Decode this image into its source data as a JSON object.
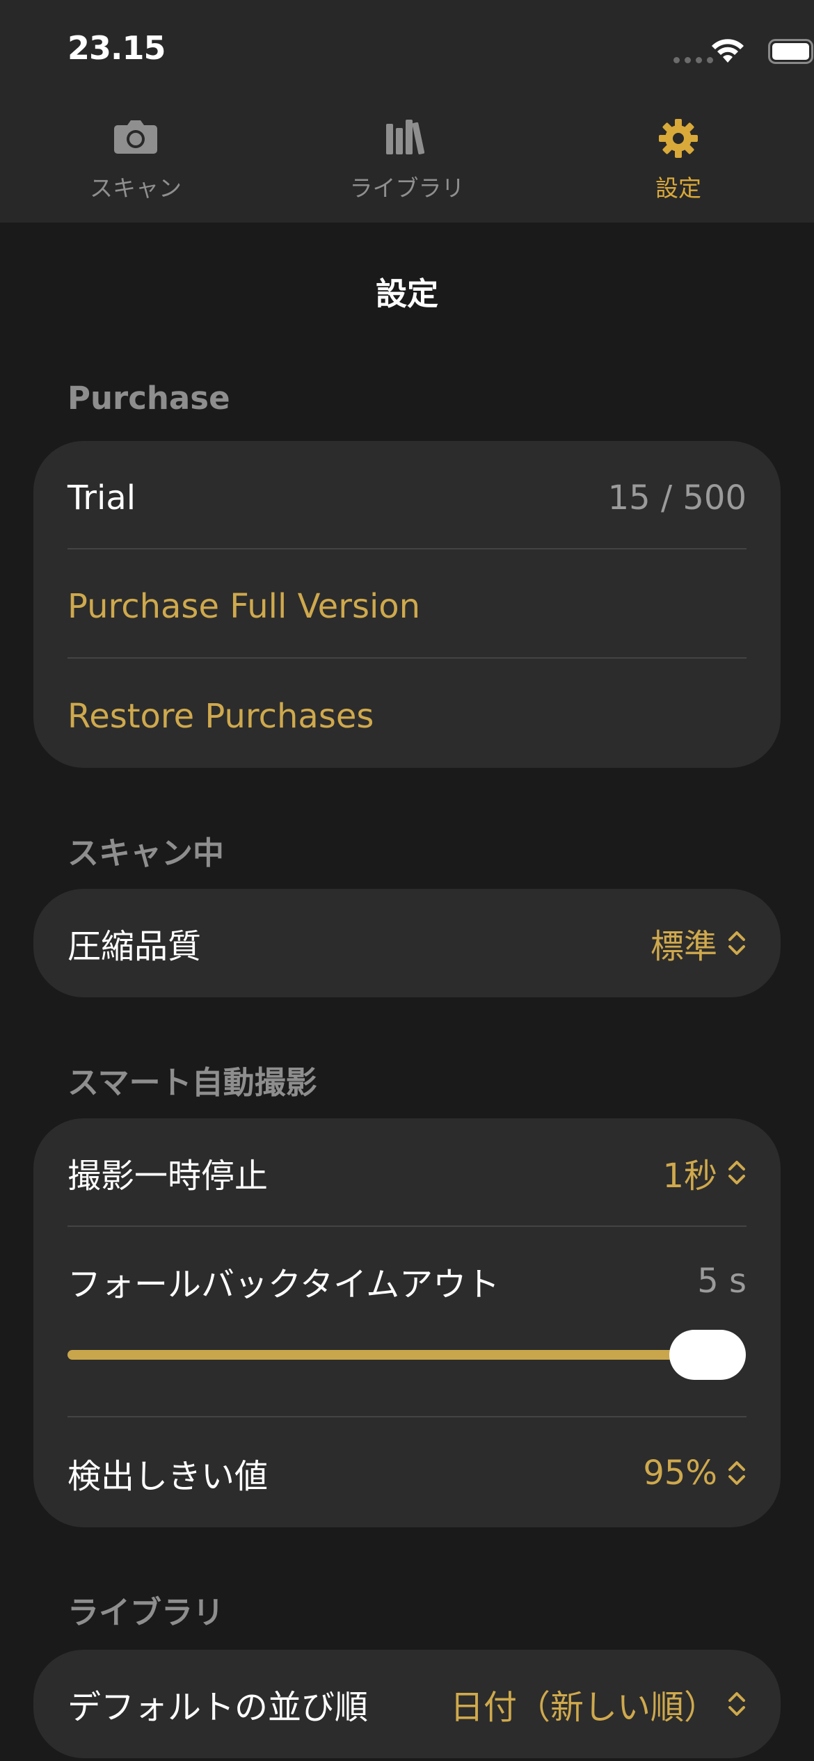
{
  "status_bar": {
    "time": "23.15"
  },
  "tabs": [
    {
      "label": "スキャン",
      "icon": "camera-icon",
      "active": false
    },
    {
      "label": "ライブラリ",
      "icon": "library-icon",
      "active": false
    },
    {
      "label": "設定",
      "icon": "gear-icon",
      "active": true
    }
  ],
  "page": {
    "title": "設定"
  },
  "purchase": {
    "header": "Purchase",
    "trial_label": "Trial",
    "trial_value": "15 / 500",
    "full_version": "Purchase Full Version",
    "restore": "Restore Purchases"
  },
  "scanning": {
    "header": "スキャン中",
    "compression_label": "圧縮品質",
    "compression_value": "標準"
  },
  "smart_capture": {
    "header": "スマート自動撮影",
    "pause_label": "撮影一時停止",
    "pause_value": "1秒",
    "fallback_label": "フォールバックタイムアウト",
    "fallback_value": "5 s",
    "fallback_slider_level": 1.0,
    "threshold_label": "検出しきい値",
    "threshold_value": "95%"
  },
  "library": {
    "header": "ライブラリ",
    "sort_label": "デフォルトの並び順",
    "sort_value": "日付（新しい順）"
  },
  "colors": {
    "accent": "#d9a93a",
    "background": "#1a1a1a",
    "card": "#2c2c2c",
    "secondary_text": "#8e8e8e"
  }
}
